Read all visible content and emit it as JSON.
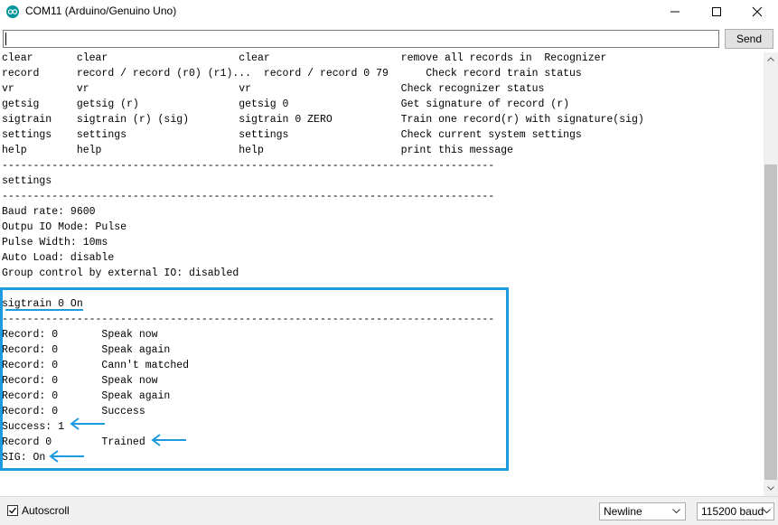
{
  "window": {
    "title": "COM11 (Arduino/Genuino Uno)"
  },
  "input": {
    "value": "",
    "send_label": "Send"
  },
  "output_lines": [
    "clear       clear                     clear                     remove all records in  Recognizer",
    "record      record / record (r0) (r1)...  record / record 0 79      Check record train status",
    "vr          vr                        vr                        Check recognizer status",
    "getsig      getsig (r)                getsig 0                  Get signature of record (r)",
    "sigtrain    sigtrain (r) (sig)        sigtrain 0 ZERO           Train one record(r) with signature(sig)",
    "settings    settings                  settings                  Check current system settings",
    "help        help                      help                      print this message",
    "-------------------------------------------------------------------------------",
    "settings",
    "-------------------------------------------------------------------------------",
    "Baud rate: 9600",
    "Outpu IO Mode: Pulse",
    "Pulse Width: 10ms",
    "Auto Load: disable",
    "Group control by external IO: disabled",
    "",
    "sigtrain 0 On",
    "-------------------------------------------------------------------------------",
    "Record: 0       Speak now",
    "Record: 0       Speak again",
    "Record: 0       Cann't matched",
    "Record: 0       Speak now",
    "Record: 0       Speak again",
    "Record: 0       Success",
    "Success: 1",
    "Record 0        Trained",
    "SIG: On"
  ],
  "footer": {
    "autoscroll_label": "Autoscroll",
    "autoscroll_checked": true,
    "line_ending": "Newline",
    "baud": "115200 baud"
  },
  "colors": {
    "annotation": "#1e9ae0",
    "arduino": "#00979c"
  }
}
